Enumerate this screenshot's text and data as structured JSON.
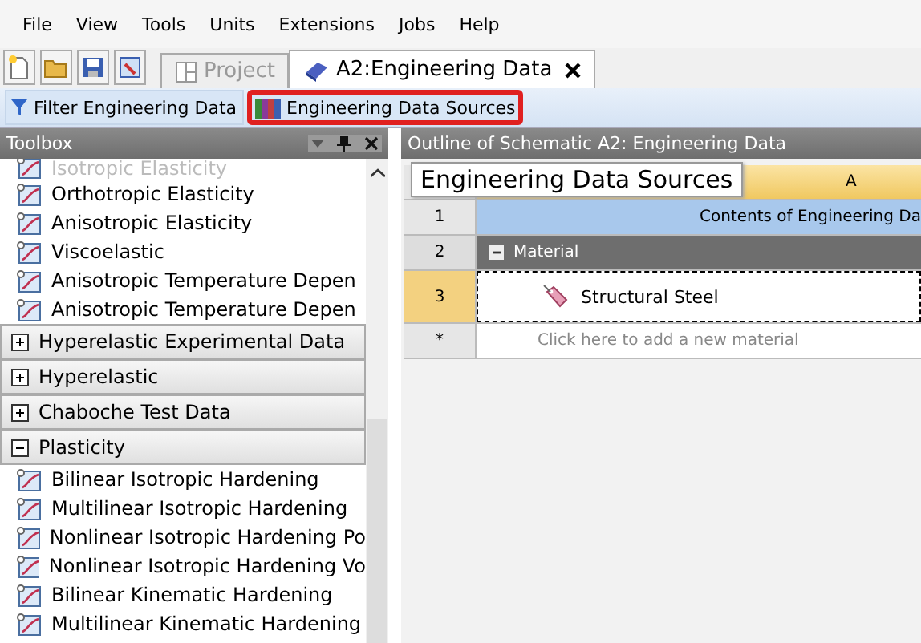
{
  "menu": [
    "File",
    "View",
    "Tools",
    "Units",
    "Extensions",
    "Jobs",
    "Help"
  ],
  "tabs": [
    {
      "label": "Project",
      "selected": false
    },
    {
      "label": "A2:Engineering Data",
      "selected": true
    }
  ],
  "toolbar": [
    {
      "label": "Filter Engineering Data",
      "kind": "filter",
      "highlighted": false
    },
    {
      "label": "Engineering Data Sources",
      "kind": "sources",
      "highlighted": true
    }
  ],
  "toolbox": {
    "title": "Toolbox",
    "items": [
      {
        "kind": "item",
        "label": "Isotropic Elasticity",
        "faded": true
      },
      {
        "kind": "item",
        "label": "Orthotropic Elasticity",
        "faded": false
      },
      {
        "kind": "item",
        "label": "Anisotropic Elasticity",
        "faded": false
      },
      {
        "kind": "item",
        "label": "Viscoelastic",
        "faded": false
      },
      {
        "kind": "item",
        "label": "Anisotropic Temperature Depen",
        "faded": false
      },
      {
        "kind": "item",
        "label": "Anisotropic Temperature Depen",
        "faded": false
      },
      {
        "kind": "category",
        "label": "Hyperelastic Experimental Data",
        "expanded": false
      },
      {
        "kind": "category",
        "label": "Hyperelastic",
        "expanded": false
      },
      {
        "kind": "category",
        "label": "Chaboche Test Data",
        "expanded": false
      },
      {
        "kind": "category",
        "label": "Plasticity",
        "expanded": true
      },
      {
        "kind": "item",
        "label": "Bilinear Isotropic Hardening",
        "faded": false
      },
      {
        "kind": "item",
        "label": "Multilinear Isotropic Hardening",
        "faded": false
      },
      {
        "kind": "item",
        "label": "Nonlinear Isotropic Hardening Po",
        "faded": false
      },
      {
        "kind": "item",
        "label": "Nonlinear Isotropic Hardening Vo",
        "faded": false
      },
      {
        "kind": "item",
        "label": "Bilinear Kinematic Hardening",
        "faded": false
      },
      {
        "kind": "item",
        "label": "Multilinear Kinematic Hardening",
        "faded": false
      }
    ]
  },
  "outline": {
    "title": "Outline of Schematic A2: Engineering Data",
    "column_header": "A",
    "tooltip": "Engineering Data Sources",
    "rows": [
      {
        "number": "1",
        "kind": "title",
        "text": "Contents of Engineering Da"
      },
      {
        "number": "2",
        "kind": "group",
        "text": "Material",
        "expanded": true
      },
      {
        "number": "3",
        "kind": "material",
        "text": "Structural Steel",
        "selected": true
      },
      {
        "number": "*",
        "kind": "new",
        "text": "Click here to add a new material"
      }
    ]
  }
}
